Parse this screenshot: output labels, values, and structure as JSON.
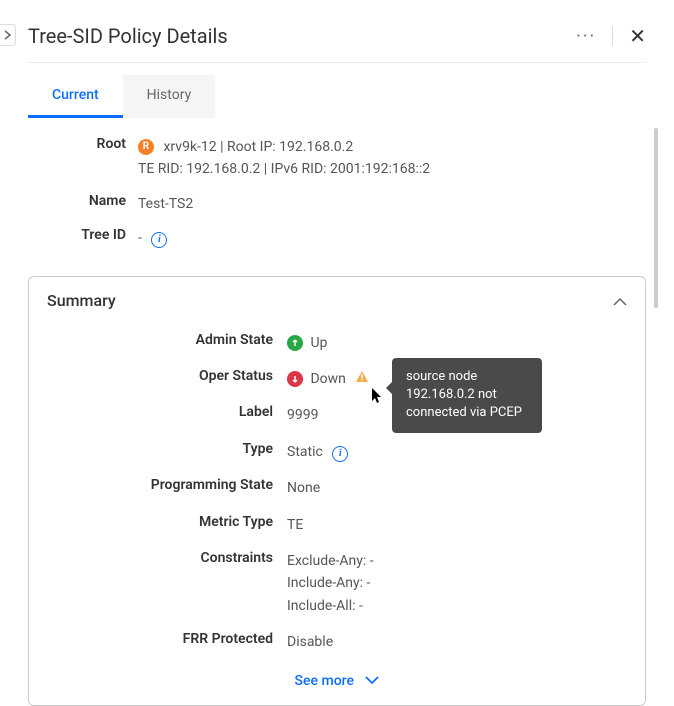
{
  "header": {
    "title": "Tree-SID Policy Details"
  },
  "tabs": {
    "current": "Current",
    "history": "History"
  },
  "details": {
    "root_label": "Root",
    "root_badge": "R",
    "root_line1": "xrv9k-12 | Root IP: 192.168.0.2",
    "root_line2": "TE RID: 192.168.0.2 | IPv6 RID: 2001:192:168::2",
    "name_label": "Name",
    "name_value": "Test-TS2",
    "treeid_label": "Tree ID",
    "treeid_value": "-"
  },
  "summary": {
    "title": "Summary",
    "fields": {
      "admin_state_label": "Admin State",
      "admin_state_value": "Up",
      "oper_status_label": "Oper Status",
      "oper_status_value": "Down",
      "label_label": "Label",
      "label_value": "9999",
      "type_label": "Type",
      "type_value": "Static",
      "prog_state_label": "Programming State",
      "prog_state_value": "None",
      "metric_label": "Metric Type",
      "metric_value": "TE",
      "constraints_label": "Constraints",
      "constraints_exclude": "Exclude-Any: -",
      "constraints_include_any": "Include-Any: -",
      "constraints_include_all": "Include-All: -",
      "frr_label": "FRR Protected",
      "frr_value": "Disable"
    },
    "see_more": "See more"
  },
  "tooltip": {
    "text": "source node 192.168.0.2 not connected via PCEP"
  }
}
